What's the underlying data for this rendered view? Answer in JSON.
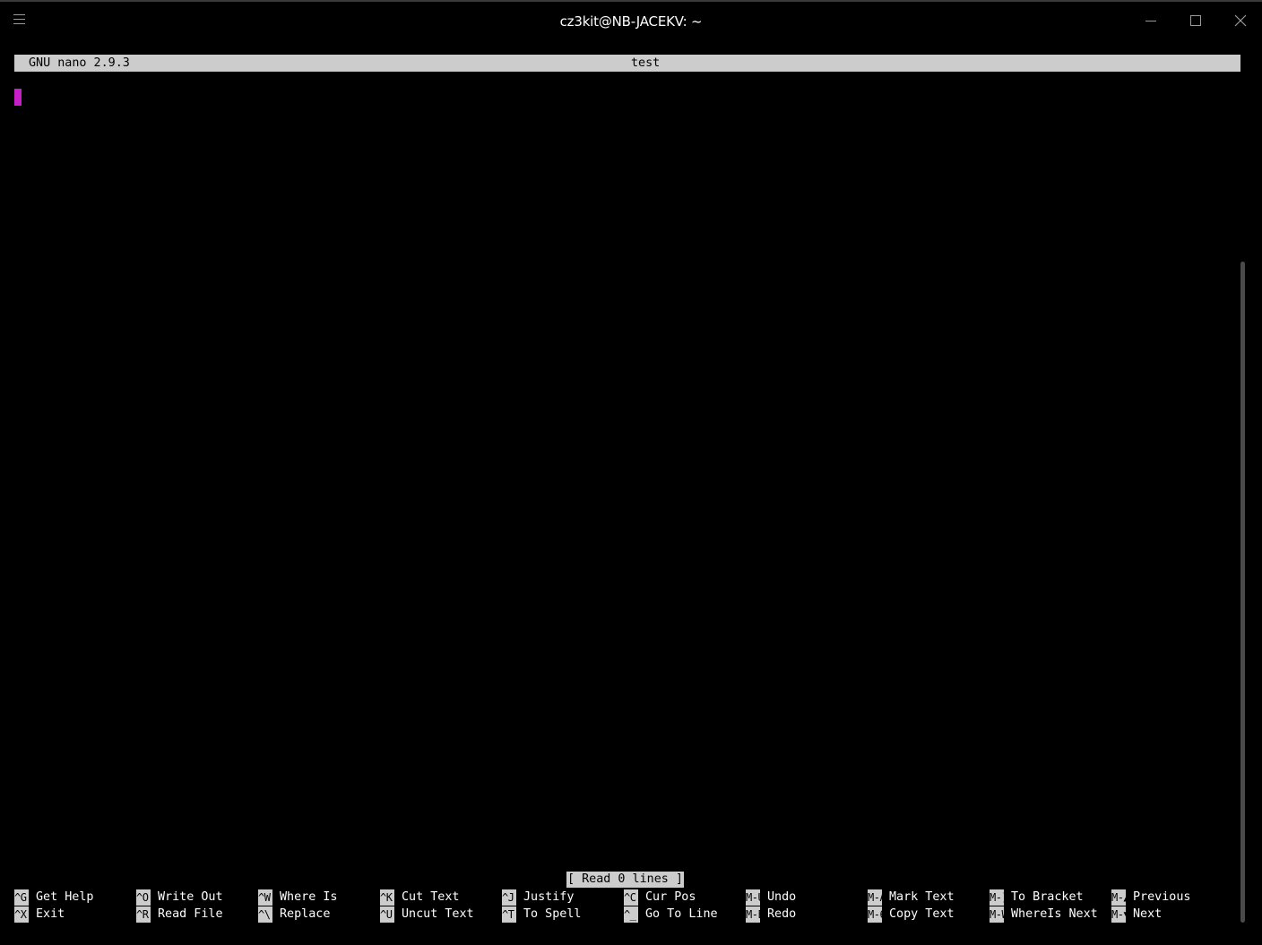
{
  "window": {
    "title": "cz3kit@NB-JACEKV: ~",
    "icons": {
      "menu": "hamburger-menu-icon",
      "minimize": "minimize-icon",
      "maximize": "maximize-icon",
      "close": "close-icon"
    }
  },
  "nano": {
    "version": "GNU nano 2.9.3",
    "filename": "test",
    "status_message": "[ Read 0 lines ]",
    "cursor_color": "#c71fc7",
    "shortcuts_row1": [
      {
        "key": "^G",
        "label": "Get Help"
      },
      {
        "key": "^O",
        "label": "Write Out"
      },
      {
        "key": "^W",
        "label": "Where Is"
      },
      {
        "key": "^K",
        "label": "Cut Text"
      },
      {
        "key": "^J",
        "label": "Justify"
      },
      {
        "key": "^C",
        "label": "Cur Pos"
      },
      {
        "key": "M-U",
        "label": "Undo"
      },
      {
        "key": "M-A",
        "label": "Mark Text"
      },
      {
        "key": "M-]",
        "label": "To Bracket"
      },
      {
        "key": "M-▲",
        "label": "Previous"
      }
    ],
    "shortcuts_row2": [
      {
        "key": "^X",
        "label": "Exit"
      },
      {
        "key": "^R",
        "label": "Read File"
      },
      {
        "key": "^\\",
        "label": "Replace"
      },
      {
        "key": "^U",
        "label": "Uncut Text"
      },
      {
        "key": "^T",
        "label": "To Spell"
      },
      {
        "key": "^_",
        "label": "Go To Line"
      },
      {
        "key": "M-E",
        "label": "Redo"
      },
      {
        "key": "M-6",
        "label": "Copy Text"
      },
      {
        "key": "M-W",
        "label": "WhereIs Next"
      },
      {
        "key": "M-▼",
        "label": "Next"
      }
    ]
  }
}
